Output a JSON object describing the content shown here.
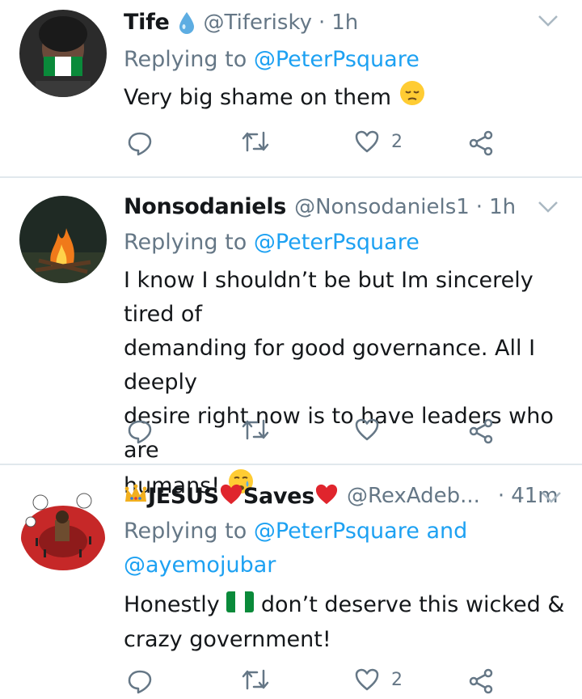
{
  "colors": {
    "accent": "#1da1f2",
    "muted": "#657786",
    "text": "#14171a",
    "divider": "#e1e8ed"
  },
  "tweets": [
    {
      "name": "Tife",
      "handle": "@Tiferisky",
      "time": "1h",
      "reply_prefix": "Replying to",
      "mentions": [
        "@PeterPsquare"
      ],
      "text": "Very big shame on them",
      "emoji": "pensive-face",
      "avatar_icon": "mask-avatar",
      "likes": "2"
    },
    {
      "name": "Nonsodaniels",
      "handle": "@Nonsodaniels1",
      "time": "1h",
      "reply_prefix": "Replying to",
      "mentions": [
        "@PeterPsquare"
      ],
      "text_lines": [
        "I know I shouldn’t be but Im sincerely tired of",
        "demanding for good governance. All I deeply",
        "desire right now is to have leaders who are",
        "humans!"
      ],
      "emoji": "crying-face",
      "avatar_icon": "bonfire-avatar",
      "likes": ""
    },
    {
      "name": "JESUS",
      "name_suffix": "Saves",
      "handle": "@RexAdeb...",
      "time": "41m",
      "reply_prefix": "Replying to",
      "mentions": [
        "@PeterPsquare",
        "@ayemojubar"
      ],
      "mention_joiner": "and",
      "text_part1": "Honestly",
      "text_part2": "don’t deserve this wicked &",
      "text_line2": "crazy government!",
      "emoji": "nigeria-flag",
      "avatar_icon": "cartoon-avatar",
      "likes": "2"
    }
  ]
}
